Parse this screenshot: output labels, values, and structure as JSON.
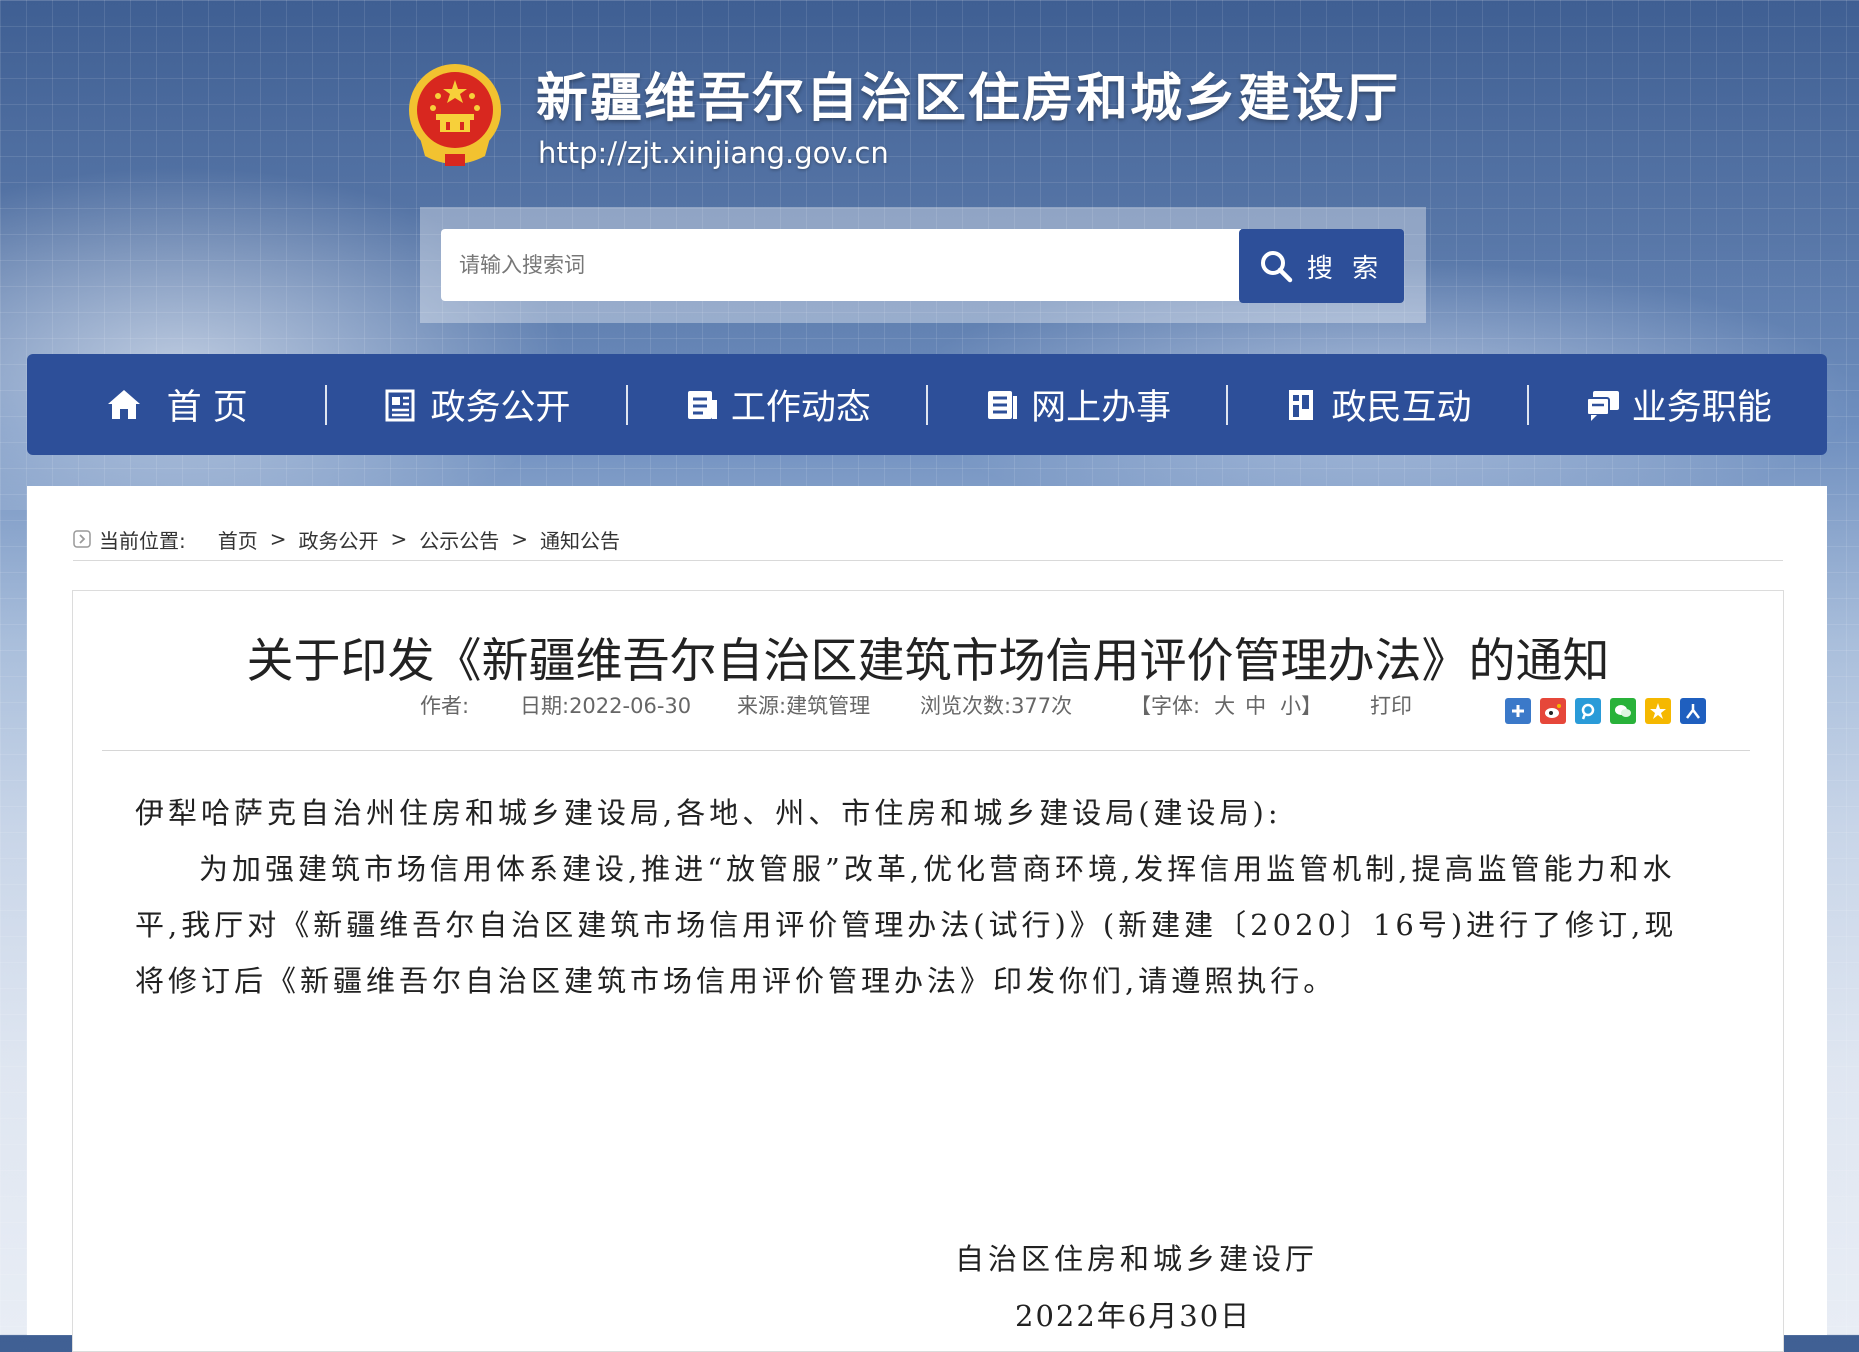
{
  "header": {
    "title": "新疆维吾尔自治区住房和城乡建设厅",
    "url": "http://zjt.xinjiang.gov.cn"
  },
  "search": {
    "placeholder": "请输入搜索词",
    "button_label": "搜 索"
  },
  "nav": {
    "items": [
      {
        "label": "首 页",
        "icon": "home-icon"
      },
      {
        "label": "政务公开",
        "icon": "document-list-icon"
      },
      {
        "label": "工作动态",
        "icon": "news-icon"
      },
      {
        "label": "网上办事",
        "icon": "service-icon"
      },
      {
        "label": "政民互动",
        "icon": "interaction-icon"
      },
      {
        "label": "业务职能",
        "icon": "chat-icon"
      }
    ]
  },
  "breadcrumb": {
    "prefix": "当前位置:",
    "items": [
      "首页",
      "政务公开",
      "公示公告",
      "通知公告"
    ],
    "separator": ">"
  },
  "article": {
    "title": "关于印发《新疆维吾尔自治区建筑市场信用评价管理办法》的通知",
    "meta": {
      "author": "作者:",
      "date": "日期:2022-06-30",
      "source": "来源:建筑管理",
      "views": "浏览次数:377次",
      "font_prefix": "【字体:",
      "font_large": "大",
      "font_medium": "中",
      "font_small": "小",
      "font_suffix": "】",
      "print": "打印"
    },
    "share_icons": [
      "plus-share-icon",
      "weibo-icon",
      "tencent-weibo-icon",
      "wechat-icon",
      "qzone-icon",
      "renren-icon"
    ],
    "paragraphs": [
      "伊犁哈萨克自治州住房和城乡建设局,各地、州、市住房和城乡建设局(建设局):",
      "为加强建筑市场信用体系建设,推进“放管服”改革,优化营商环境,发挥信用监管机制,提高监管能力和水平,我厅对《新疆维吾尔自治区建筑市场信用评价管理办法(试行)》(新建建〔2020〕16号)进行了修订,现将修订后《新疆维吾尔自治区建筑市场信用评价管理办法》印发你们,请遵照执行。"
    ],
    "signature_org": "自治区住房和城乡建设厅",
    "signature_date": "2022年6月30日"
  },
  "colors": {
    "nav_bg": "#2d4f99",
    "search_button": "#2d4f99"
  }
}
